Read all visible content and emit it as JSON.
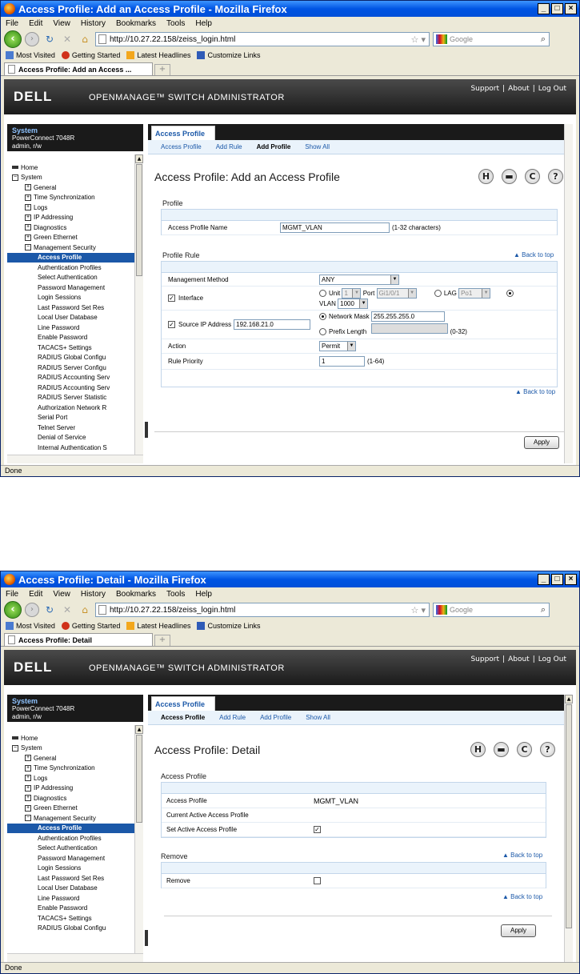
{
  "window1": {
    "title": "Access Profile: Add an Access Profile - Mozilla Firefox",
    "tab_label": "Access Profile: Add an Access ...",
    "page_title": "Access Profile: Add an Access Profile",
    "status": "Done"
  },
  "window2": {
    "title": "Access Profile: Detail - Mozilla Firefox",
    "tab_label": "Access Profile: Detail",
    "page_title": "Access Profile: Detail",
    "status": "Done"
  },
  "browser": {
    "menu": [
      "File",
      "Edit",
      "View",
      "History",
      "Bookmarks",
      "Tools",
      "Help"
    ],
    "url": "http://10.27.22.158/zeiss_login.html",
    "search_placeholder": "Google",
    "bookmarks": [
      "Most Visited",
      "Getting Started",
      "Latest Headlines",
      "Customize Links"
    ]
  },
  "dell": {
    "logo": "DELL",
    "product": "OPENMANAGE™ SWITCH ADMINISTRATOR",
    "links": [
      "Support",
      "|",
      "About",
      "|",
      "Log Out"
    ]
  },
  "system": {
    "title": "System",
    "model": "PowerConnect 7048R",
    "user": "admin, r/w"
  },
  "tree1": [
    {
      "label": "Home",
      "type": "home",
      "indent": 0
    },
    {
      "label": "System",
      "type": "minus",
      "indent": 0
    },
    {
      "label": "General",
      "type": "plus",
      "indent": 1
    },
    {
      "label": "Time Synchronization",
      "type": "plus",
      "indent": 1
    },
    {
      "label": "Logs",
      "type": "plus",
      "indent": 1
    },
    {
      "label": "IP Addressing",
      "type": "plus",
      "indent": 1
    },
    {
      "label": "Diagnostics",
      "type": "plus",
      "indent": 1
    },
    {
      "label": "Green Ethernet",
      "type": "plus",
      "indent": 1
    },
    {
      "label": "Management Security",
      "type": "minus",
      "indent": 1
    },
    {
      "label": "Access Profile",
      "type": "leaf",
      "indent": 2,
      "selected": true
    },
    {
      "label": "Authentication Profiles",
      "type": "leaf",
      "indent": 2
    },
    {
      "label": "Select Authentication",
      "type": "leaf",
      "indent": 2
    },
    {
      "label": "Password Management",
      "type": "leaf",
      "indent": 2
    },
    {
      "label": "Login Sessions",
      "type": "leaf",
      "indent": 2
    },
    {
      "label": "Last Password Set Res",
      "type": "leaf",
      "indent": 2
    },
    {
      "label": "Local User Database",
      "type": "leaf",
      "indent": 2
    },
    {
      "label": "Line Password",
      "type": "leaf",
      "indent": 2
    },
    {
      "label": "Enable Password",
      "type": "leaf",
      "indent": 2
    },
    {
      "label": "TACACS+ Settings",
      "type": "leaf",
      "indent": 2
    },
    {
      "label": "RADIUS Global Configu",
      "type": "leaf",
      "indent": 2
    },
    {
      "label": "RADIUS Server Configu",
      "type": "leaf",
      "indent": 2
    },
    {
      "label": "RADIUS Accounting Serv",
      "type": "leaf",
      "indent": 2
    },
    {
      "label": "RADIUS Accounting Serv",
      "type": "leaf",
      "indent": 2
    },
    {
      "label": "RADIUS Server Statistic",
      "type": "leaf",
      "indent": 2
    },
    {
      "label": "Authorization Network R",
      "type": "leaf",
      "indent": 2
    },
    {
      "label": "Serial Port",
      "type": "leaf",
      "indent": 2
    },
    {
      "label": "Telnet Server",
      "type": "leaf",
      "indent": 2
    },
    {
      "label": "Denial of Service",
      "type": "leaf",
      "indent": 2
    },
    {
      "label": "Internal Authentication S",
      "type": "leaf",
      "indent": 2
    }
  ],
  "tree2_count": 20,
  "main_tab": "Access Profile",
  "subnav": [
    "Access Profile",
    "Add Rule",
    "Add Profile",
    "Show All"
  ],
  "subnav_active1": "Add Profile",
  "subnav_active2": "Access Profile",
  "icons": [
    "save-icon",
    "print-icon",
    "refresh-icon",
    "help-icon"
  ],
  "form1": {
    "profile_section": "Profile",
    "profile_name_label": "Access Profile Name",
    "profile_name_value": "MGMT_VLAN",
    "profile_name_hint": "(1-32 characters)",
    "rule_section": "Profile Rule",
    "back_to_top": "Back to top",
    "mgmt_method_label": "Management Method",
    "mgmt_method_value": "ANY",
    "interface_label": "Interface",
    "unit_label": "Unit",
    "unit_value": "1",
    "port_label": "Port",
    "port_value": "Gi1/0/1",
    "lag_label": "LAG",
    "lag_value": "Po1",
    "vlan_label": "VLAN",
    "vlan_value": "1000",
    "source_ip_label": "Source IP Address",
    "source_ip_value": "192.168.21.0",
    "network_mask_label": "Network Mask",
    "network_mask_value": "255.255.255.0",
    "prefix_length_label": "Prefix Length",
    "prefix_length_hint": "(0-32)",
    "action_label": "Action",
    "action_value": "Permit",
    "rule_priority_label": "Rule Priority",
    "rule_priority_value": "1",
    "rule_priority_hint": "(1-64)",
    "apply": "Apply"
  },
  "form2": {
    "section": "Access Profile",
    "access_profile_label": "Access Profile",
    "access_profile_value": "MGMT_VLAN",
    "current_active_label": "Current Active Access Profile",
    "set_active_label": "Set Active Access Profile",
    "remove_section": "Remove",
    "remove_label": "Remove",
    "back_to_top": "Back to top",
    "apply": "Apply"
  }
}
